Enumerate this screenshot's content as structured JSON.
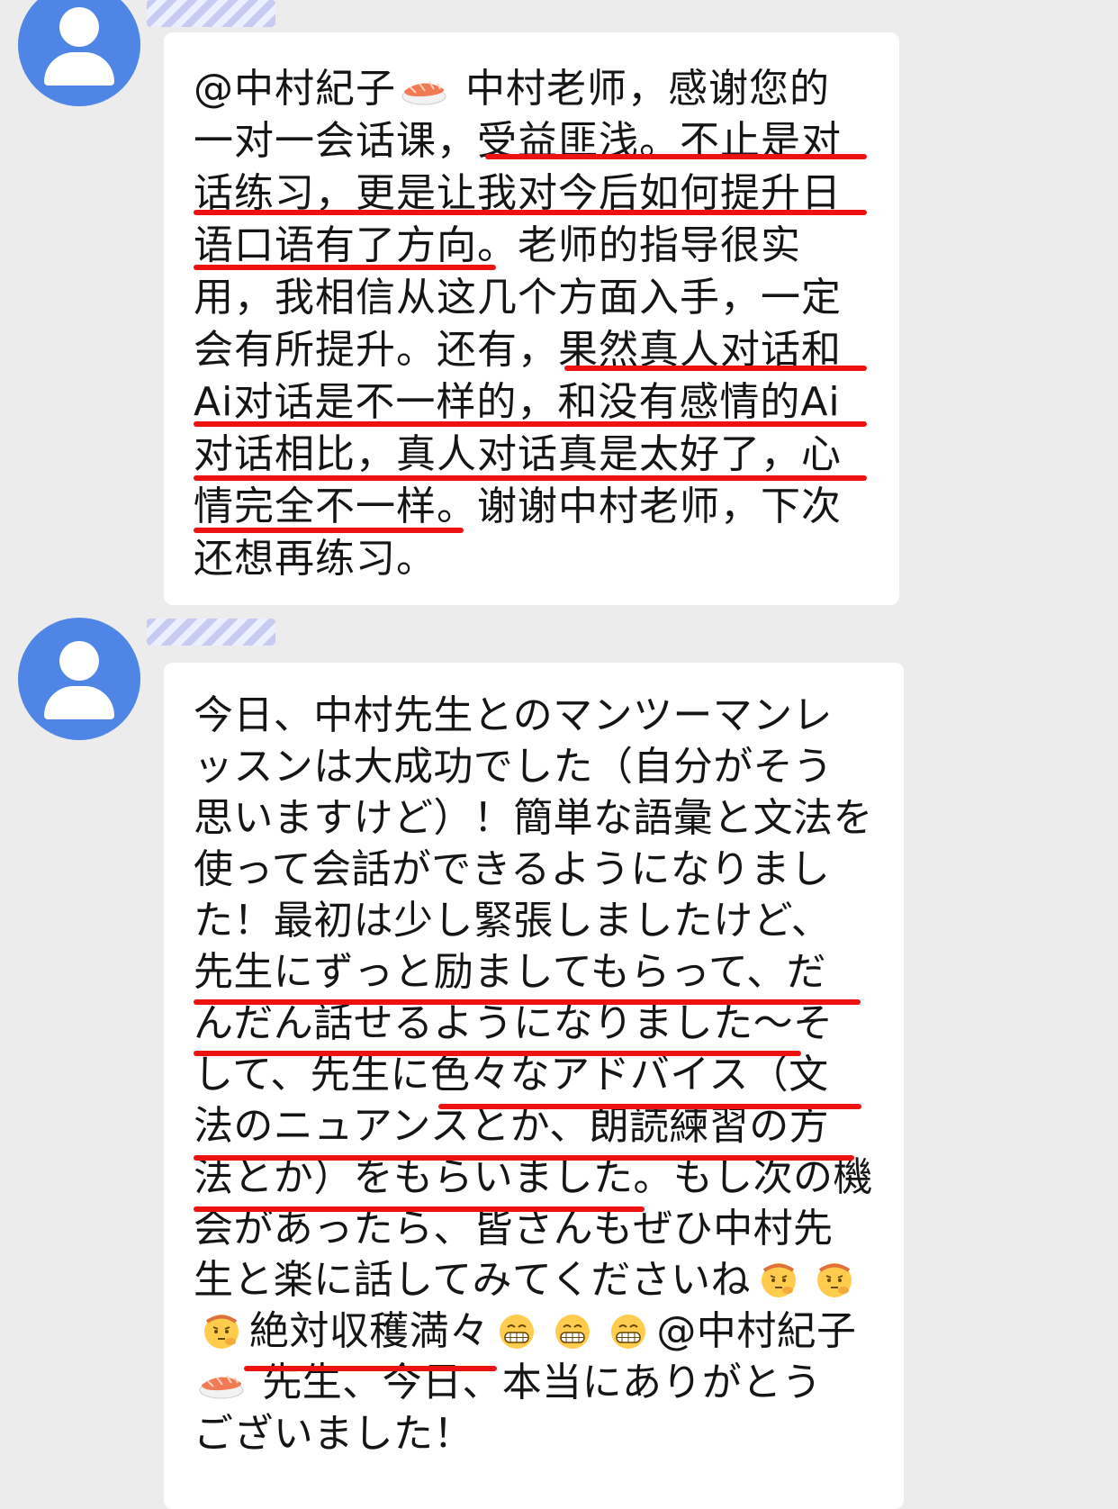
{
  "colors": {
    "background": "#ececec",
    "bubble": "#ffffff",
    "avatar": "#4f86e6",
    "underline": "#ee1111"
  },
  "messages": [
    {
      "avatar_icon": "user-avatar-icon",
      "lines": [
        [
          "@中村紀子",
          "{sushi}",
          " 中村老师，感谢您的"
        ],
        [
          "一对一会话课，受益匪浅。不止是对"
        ],
        [
          "话练习，更是让我对今后如何提升日"
        ],
        [
          "语口语有了方向。老师的指导很实"
        ],
        [
          "用，我相信从这几个方面入手，一定"
        ],
        [
          "会有所提升。还有，果然真人对话和"
        ],
        [
          "Ai对话是不一样的，和没有感情的Ai"
        ],
        [
          "对话相比，真人对话真是太好了，心"
        ],
        [
          "情完全不一样。谢谢中村老师，下次"
        ],
        [
          "还想再练习。"
        ]
      ]
    },
    {
      "avatar_icon": "user-avatar-icon",
      "lines": [
        [
          "今日、中村先生とのマンツーマンレ"
        ],
        [
          "ッスンは大成功でした（自分がそう"
        ],
        [
          "思いますけど）！簡単な語彙と文法を"
        ],
        [
          "使って会話ができるようになりまし"
        ],
        [
          "た！最初は少し緊張しましたけど、"
        ],
        [
          "先生にずっと励ましてもらって、だ"
        ],
        [
          "んだん話せるようになりました～そ"
        ],
        [
          "して、先生に色々なアドバイス（文"
        ],
        [
          "法のニュアンスとか、朗読練習の方"
        ],
        [
          "法とか）をもらいました。もし次の機"
        ],
        [
          "会があったら、皆さんもぜひ中村先"
        ],
        [
          "生と楽に話してみてくださいね",
          "{thinking}",
          "{thinking}"
        ],
        [
          "{thinking}",
          "絶対収穫満々",
          "{grin}",
          "{grin}",
          "{grin}",
          "@中村紀子"
        ],
        [
          "{sushi}",
          " 先生、今日、本当にありがとう"
        ],
        [
          "ございました！"
        ]
      ]
    }
  ]
}
